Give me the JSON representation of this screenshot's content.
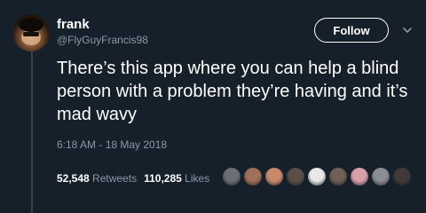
{
  "author": {
    "display_name": "frank",
    "handle": "@FlyGuyFrancis98"
  },
  "follow_label": "Follow",
  "tweet": {
    "text": "There’s this app where you can help a blind person with a problem they’re having and it’s mad wavy",
    "timestamp": "6:18 AM - 18 May 2018"
  },
  "stats": {
    "retweets_count": "52,548",
    "retweets_label": "Retweets",
    "likes_count": "110,285",
    "likes_label": "Likes"
  },
  "liker_avatar_colors": [
    "#6b6f75",
    "#a0705a",
    "#c98a6a",
    "#5a4e48",
    "#e8e8e8",
    "#6f5f55",
    "#d8a0a8",
    "#8a8f96",
    "#3f3a38"
  ],
  "colors": {
    "background": "#15202b",
    "secondary_text": "#8899a6",
    "primary_text": "#ffffff"
  }
}
